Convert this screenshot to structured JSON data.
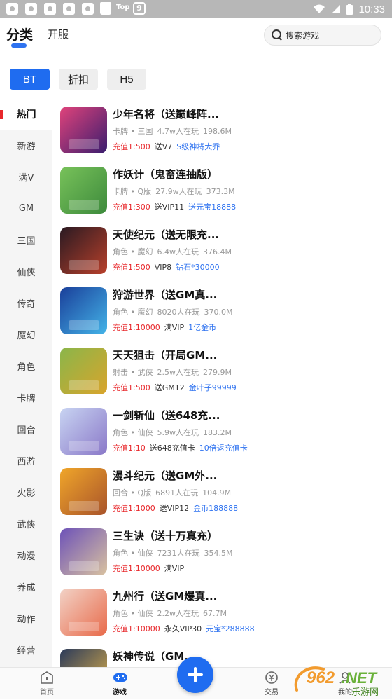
{
  "status_bar": {
    "top_label": "Top",
    "q_label": "9",
    "time": "10:33"
  },
  "header": {
    "tabs": [
      {
        "label": "分类",
        "active": true
      },
      {
        "label": "开服",
        "active": false
      }
    ],
    "search_placeholder": "搜索游戏"
  },
  "chips": [
    {
      "label": "BT",
      "active": true
    },
    {
      "label": "折扣",
      "active": false
    },
    {
      "label": "H5",
      "active": false
    }
  ],
  "sidebar": {
    "items": [
      {
        "label": "热门",
        "active": true
      },
      {
        "label": "新游"
      },
      {
        "label": "满V"
      },
      {
        "label": "GM"
      },
      {
        "label": "三国"
      },
      {
        "label": "仙侠"
      },
      {
        "label": "传奇"
      },
      {
        "label": "魔幻"
      },
      {
        "label": "角色"
      },
      {
        "label": "卡牌"
      },
      {
        "label": "回合"
      },
      {
        "label": "西游"
      },
      {
        "label": "火影"
      },
      {
        "label": "武侠"
      },
      {
        "label": "动漫"
      },
      {
        "label": "养成"
      },
      {
        "label": "动作"
      },
      {
        "label": "经营"
      }
    ]
  },
  "games": [
    {
      "name": "少年名将（送巅峰阵...",
      "category": "卡牌 • 三国",
      "players": "4.7w人在玩",
      "size": "198.6M",
      "rate": "充值1:500",
      "gift": "送V7",
      "bonus": "S级神将大乔",
      "colors": [
        "#e0437b",
        "#3a1d6e"
      ]
    },
    {
      "name": "作妖计（鬼畜连抽版）",
      "category": "卡牌 • Q版",
      "players": "27.9w人在玩",
      "size": "373.3M",
      "rate": "充值1:300",
      "gift": "送VIP11",
      "bonus": "送元宝18888",
      "colors": [
        "#78c25a",
        "#3d8a3c"
      ]
    },
    {
      "name": "天使纪元（送无限充...",
      "category": "角色 • 魔幻",
      "players": "6.4w人在玩",
      "size": "376.4M",
      "rate": "充值1:500",
      "gift": "VIP8",
      "bonus": "钻石*30000",
      "colors": [
        "#2a1a22",
        "#b8402b"
      ]
    },
    {
      "name": "狩游世界（送GM真...",
      "category": "角色 • 魔幻",
      "players": "8020人在玩",
      "size": "370.0M",
      "rate": "充值1:10000",
      "gift": "满VIP",
      "bonus": "1亿金币",
      "colors": [
        "#1a3f9a",
        "#44b4e8"
      ]
    },
    {
      "name": "天天狙击（开局GM...",
      "category": "射击 • 武侠",
      "players": "2.5w人在玩",
      "size": "279.9M",
      "rate": "充值1:500",
      "gift": "送GM12",
      "bonus": "金叶子99999",
      "colors": [
        "#8ab64a",
        "#d9a42c"
      ]
    },
    {
      "name": "一剑斩仙（送648充...",
      "category": "角色 • 仙侠",
      "players": "5.9w人在玩",
      "size": "183.2M",
      "rate": "充值1:10",
      "gift": "送648充值卡",
      "bonus": "10倍返充值卡",
      "colors": [
        "#c8d4f2",
        "#8a78c8"
      ]
    },
    {
      "name": "漫斗纪元（送GM外...",
      "category": "回合 • Q版",
      "players": "6891人在玩",
      "size": "104.9M",
      "rate": "充值1:1000",
      "gift": "送VIP12",
      "bonus": "金币188888",
      "colors": [
        "#f0a62a",
        "#a8532a"
      ]
    },
    {
      "name": "三生诀（送十万真充）",
      "category": "角色 • 仙侠",
      "players": "7231人在玩",
      "size": "354.5M",
      "rate": "充值1:10000",
      "gift": "满VIP",
      "bonus": "",
      "colors": [
        "#6d52b8",
        "#d9c2a0"
      ]
    },
    {
      "name": "九州行（送GM爆真...",
      "category": "角色 • 仙侠",
      "players": "2.2w人在玩",
      "size": "67.7M",
      "rate": "充值1:10000",
      "gift": "永久VIP30",
      "bonus": "元宝*288888",
      "colors": [
        "#f2d2c6",
        "#e86a4a"
      ]
    },
    {
      "name": "妖神传说（GM...",
      "category": "",
      "players": "",
      "size": "",
      "rate": "",
      "gift": "",
      "bonus": "",
      "colors": [
        "#2b3a5a",
        "#e0b24a"
      ]
    }
  ],
  "bottom_nav": [
    {
      "label": "首页",
      "icon": "home-icon"
    },
    {
      "label": "游戏",
      "icon": "gamepad-icon",
      "active": true
    },
    {
      "label": "交易",
      "icon": "trade-icon"
    },
    {
      "label": "我的",
      "icon": "user-icon"
    }
  ],
  "watermark": {
    "text": "962.NET",
    "sub": "乐游网"
  },
  "accent_color": "#1f6cf0",
  "highlight_color": "#e8272b"
}
